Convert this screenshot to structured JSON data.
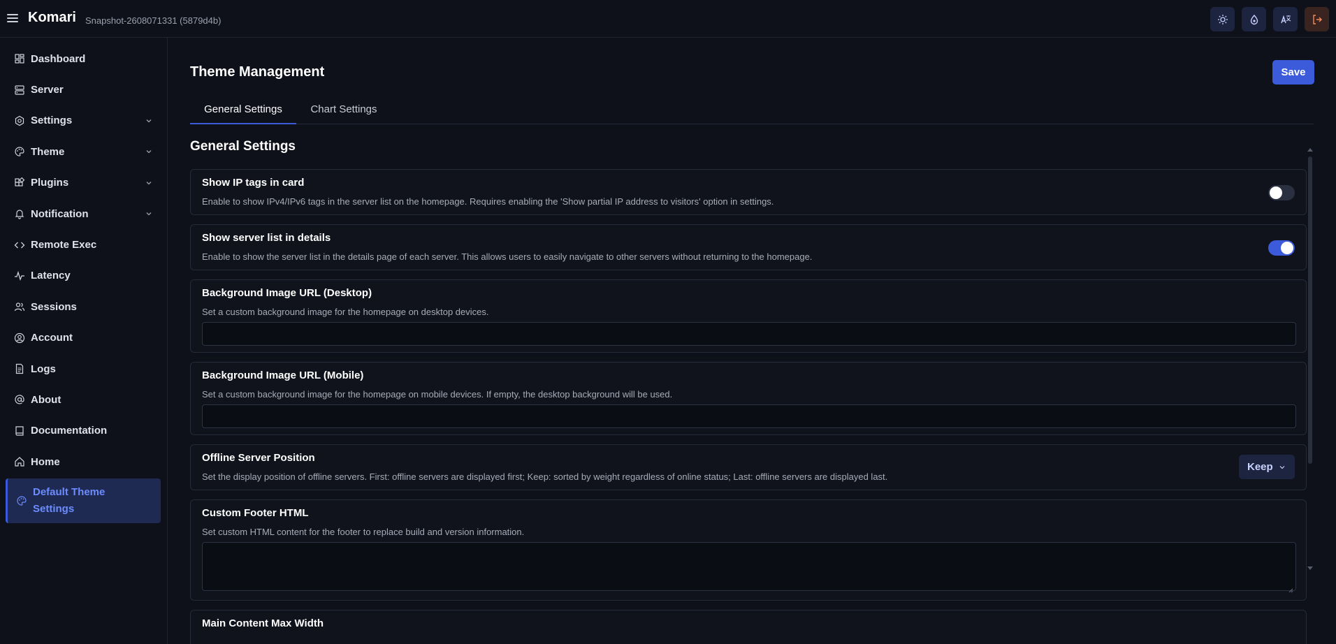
{
  "header": {
    "brand": "Komari",
    "snapshot": "Snapshot-2608071331 (5879d4b)",
    "actions": [
      {
        "icon": "sun-icon"
      },
      {
        "icon": "droplet-icon"
      },
      {
        "icon": "translate-icon"
      },
      {
        "icon": "logout-icon"
      }
    ]
  },
  "sidebar": {
    "items": [
      {
        "label": "Dashboard",
        "icon": "dashboard-icon"
      },
      {
        "label": "Server",
        "icon": "server-icon"
      },
      {
        "label": "Settings",
        "icon": "settings-icon",
        "expandable": true
      },
      {
        "label": "Theme",
        "icon": "palette-icon",
        "expandable": true
      },
      {
        "label": "Plugins",
        "icon": "plugins-icon",
        "expandable": true
      },
      {
        "label": "Notification",
        "icon": "bell-icon",
        "expandable": true
      },
      {
        "label": "Remote Exec",
        "icon": "code-icon"
      },
      {
        "label": "Latency",
        "icon": "activity-icon"
      },
      {
        "label": "Sessions",
        "icon": "users-icon"
      },
      {
        "label": "Account",
        "icon": "user-circle-icon"
      },
      {
        "label": "Logs",
        "icon": "file-icon"
      },
      {
        "label": "About",
        "icon": "at-icon"
      },
      {
        "label": "Documentation",
        "icon": "book-icon"
      },
      {
        "label": "Home",
        "icon": "home-icon"
      },
      {
        "label": "Default Theme Settings",
        "icon": "palette-icon",
        "active": true
      }
    ]
  },
  "main": {
    "title": "Theme Management",
    "save_label": "Save",
    "tabs": [
      {
        "label": "General Settings",
        "active": true
      },
      {
        "label": "Chart Settings",
        "active": false
      }
    ],
    "section_title": "General Settings",
    "settings": {
      "ip_tags": {
        "title": "Show IP tags in card",
        "desc": "Enable to show IPv4/IPv6 tags in the server list on the homepage. Requires enabling the 'Show partial IP address to visitors' option in settings.",
        "enabled": false
      },
      "server_list": {
        "title": "Show server list in details",
        "desc": "Enable to show the server list in the details page of each server. This allows users to easily navigate to other servers without returning to the homepage.",
        "enabled": true
      },
      "bg_desktop": {
        "title": "Background Image URL (Desktop)",
        "desc": "Set a custom background image for the homepage on desktop devices.",
        "value": ""
      },
      "bg_mobile": {
        "title": "Background Image URL (Mobile)",
        "desc": "Set a custom background image for the homepage on mobile devices. If empty, the desktop background will be used.",
        "value": ""
      },
      "offline_position": {
        "title": "Offline Server Position",
        "desc": "Set the display position of offline servers. First: offline servers are displayed first; Keep: sorted by weight regardless of online status; Last: offline servers are displayed last.",
        "value": "Keep"
      },
      "custom_footer": {
        "title": "Custom Footer HTML",
        "desc": "Set custom HTML content for the footer to replace build and version information.",
        "value": ""
      },
      "max_width": {
        "title": "Main Content Max Width"
      }
    }
  },
  "colors": {
    "accent": "#3b5bdb",
    "background": "#0f111a",
    "card_border": "#262b3a"
  }
}
